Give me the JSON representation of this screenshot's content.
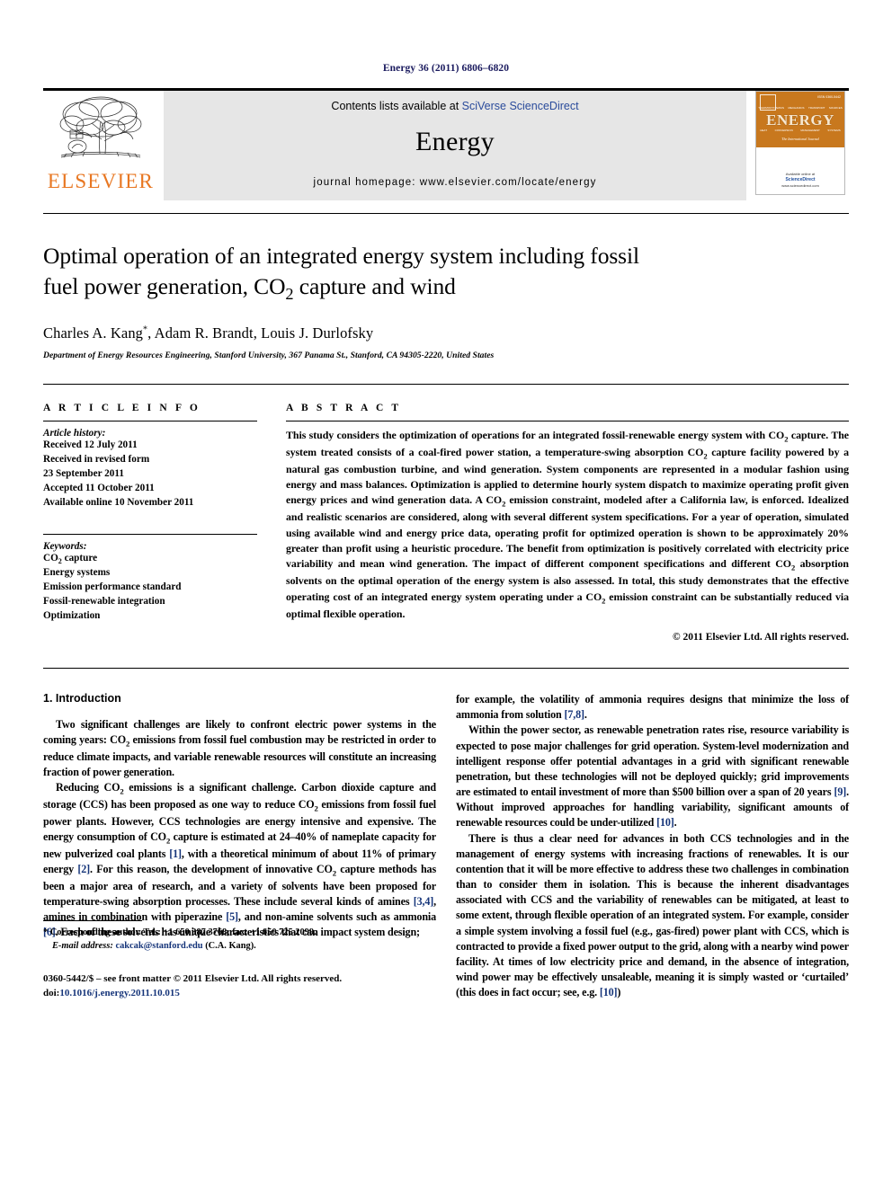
{
  "running_head": "Energy 36 (2011) 6806–6820",
  "masthead": {
    "publisher_name": "ELSEVIER",
    "contents_prefix": "Contents lists available at ",
    "contents_link": "SciVerse ScienceDirect",
    "journal_name": "Energy",
    "journal_homepage": "journal homepage: www.elsevier.com/locate/energy",
    "cover": {
      "title": "ENERGY",
      "subtitle": "The International Journal",
      "code": "ISSN 0360-5442",
      "top_words": [
        "THERMODYNAMICS",
        "MECHANICS",
        "TRANSPORT",
        "SOURCES"
      ],
      "bottom_words": [
        "HEAT",
        "CONVERSION",
        "MANAGEMENT",
        "SYSTEMS"
      ],
      "available_online": "Available online at",
      "platform": "ScienceDirect",
      "url": "www.sciencedirect.com"
    }
  },
  "article": {
    "title_line1": "Optimal operation of an integrated energy system including fossil",
    "title_line2_a": "fuel power generation, CO",
    "title_line2_sub": "2",
    "title_line2_b": " capture and wind",
    "authors": "Charles A. Kang",
    "authors_rest": ", Adam R. Brandt, Louis J. Durlofsky",
    "author_marker": "*",
    "affiliation": "Department of Energy Resources Engineering, Stanford University, 367 Panama St., Stanford, CA 94305-2220, United States"
  },
  "info": {
    "heading": "A R T I C L E   I N F O",
    "history_label": "Article history:",
    "history": [
      "Received 12 July 2011",
      "Received in revised form",
      "23 September 2011",
      "Accepted 11 October 2011",
      "Available online 10 November 2011"
    ],
    "keywords_label": "Keywords:",
    "keywords": [
      "CO2 capture",
      "Energy systems",
      "Emission performance standard",
      "Fossil-renewable integration",
      "Optimization"
    ]
  },
  "abstract": {
    "heading": "A B S T R A C T",
    "text": "This study considers the optimization of operations for an integrated fossil-renewable energy system with CO2 capture. The system treated consists of a coal-fired power station, a temperature-swing absorption CO2 capture facility powered by a natural gas combustion turbine, and wind generation. System components are represented in a modular fashion using energy and mass balances. Optimization is applied to determine hourly system dispatch to maximize operating profit given energy prices and wind generation data. A CO2 emission constraint, modeled after a California law, is enforced. Idealized and realistic scenarios are considered, along with several different system specifications. For a year of operation, simulated using available wind and energy price data, operating profit for optimized operation is shown to be approximately 20% greater than profit using a heuristic procedure. The benefit from optimization is positively correlated with electricity price variability and mean wind generation. The impact of different component specifications and different CO2 absorption solvents on the optimal operation of the energy system is also assessed. In total, this study demonstrates that the effective operating cost of an integrated energy system operating under a CO2 emission constraint can be substantially reduced via optimal flexible operation.",
    "copyright": "© 2011 Elsevier Ltd. All rights reserved."
  },
  "body": {
    "section_number_title": "1.  Introduction",
    "left_paragraphs": [
      "Two significant challenges are likely to confront electric power systems in the coming years: CO2 emissions from fossil fuel combustion may be restricted in order to reduce climate impacts, and variable renewable resources will constitute an increasing fraction of power generation.",
      "Reducing CO2 emissions is a significant challenge. Carbon dioxide capture and storage (CCS) has been proposed as one way to reduce CO2 emissions from fossil fuel power plants. However, CCS technologies are energy intensive and expensive. The energy consumption of CO2 capture is estimated at 24–40% of nameplate capacity for new pulverized coal plants [1], with a theoretical minimum of about 11% of primary energy [2]. For this reason, the development of innovative CO2 capture methods has been a major area of research, and a variety of solvents have been proposed for temperature-swing absorption processes. These include several kinds of amines [3,4], amines in combination with piperazine [5], and non-amine solvents such as ammonia [6]. Each of these solvents has unique characteristics that can impact system design;"
    ],
    "right_paragraphs": [
      "for example, the volatility of ammonia requires designs that minimize the loss of ammonia from solution [7,8].",
      "Within the power sector, as renewable penetration rates rise, resource variability is expected to pose major challenges for grid operation. System-level modernization and intelligent response offer potential advantages in a grid with significant renewable penetration, but these technologies will not be deployed quickly; grid improvements are estimated to entail investment of more than $500 billion over a span of 20 years [9]. Without improved approaches for handling variability, significant amounts of renewable resources could be under-utilized [10].",
      "There is thus a clear need for advances in both CCS technologies and in the management of energy systems with increasing fractions of renewables. It is our contention that it will be more effective to address these two challenges in combination than to consider them in isolation. This is because the inherent disadvantages associated with CCS and the variability of renewables can be mitigated, at least to some extent, through flexible operation of an integrated system. For example, consider a simple system involving a fossil fuel (e.g., gas-fired) power plant with CCS, which is contracted to provide a fixed power output to the grid, along with a nearby wind power facility. At times of low electricity price and demand, in the absence of integration, wind power may be effectively unsaleable, meaning it is simply wasted or 'curtailed' (this does in fact occur; see, e.g. [10])"
    ]
  },
  "footnotes": {
    "corresponding_marker": "*",
    "corresponding_text": " Corresponding author. Tel.: +1 650 387 3768; fax: +1 650 725 2099.",
    "email_label": "E-mail address:",
    "email": "cakcak@stanford.edu",
    "email_suffix": " (C.A. Kang).",
    "issn_line": "0360-5442/$ – see front matter © 2011 Elsevier Ltd. All rights reserved.",
    "doi_label": "doi:",
    "doi_value": "10.1016/j.energy.2011.10.015"
  },
  "colors": {
    "link_blue": "#2a4b9b",
    "reference_blue": "#16357a",
    "elsevier_orange": "#e87722",
    "cover_orange": "#c8781e",
    "masthead_gray": "#e6e6e6"
  }
}
